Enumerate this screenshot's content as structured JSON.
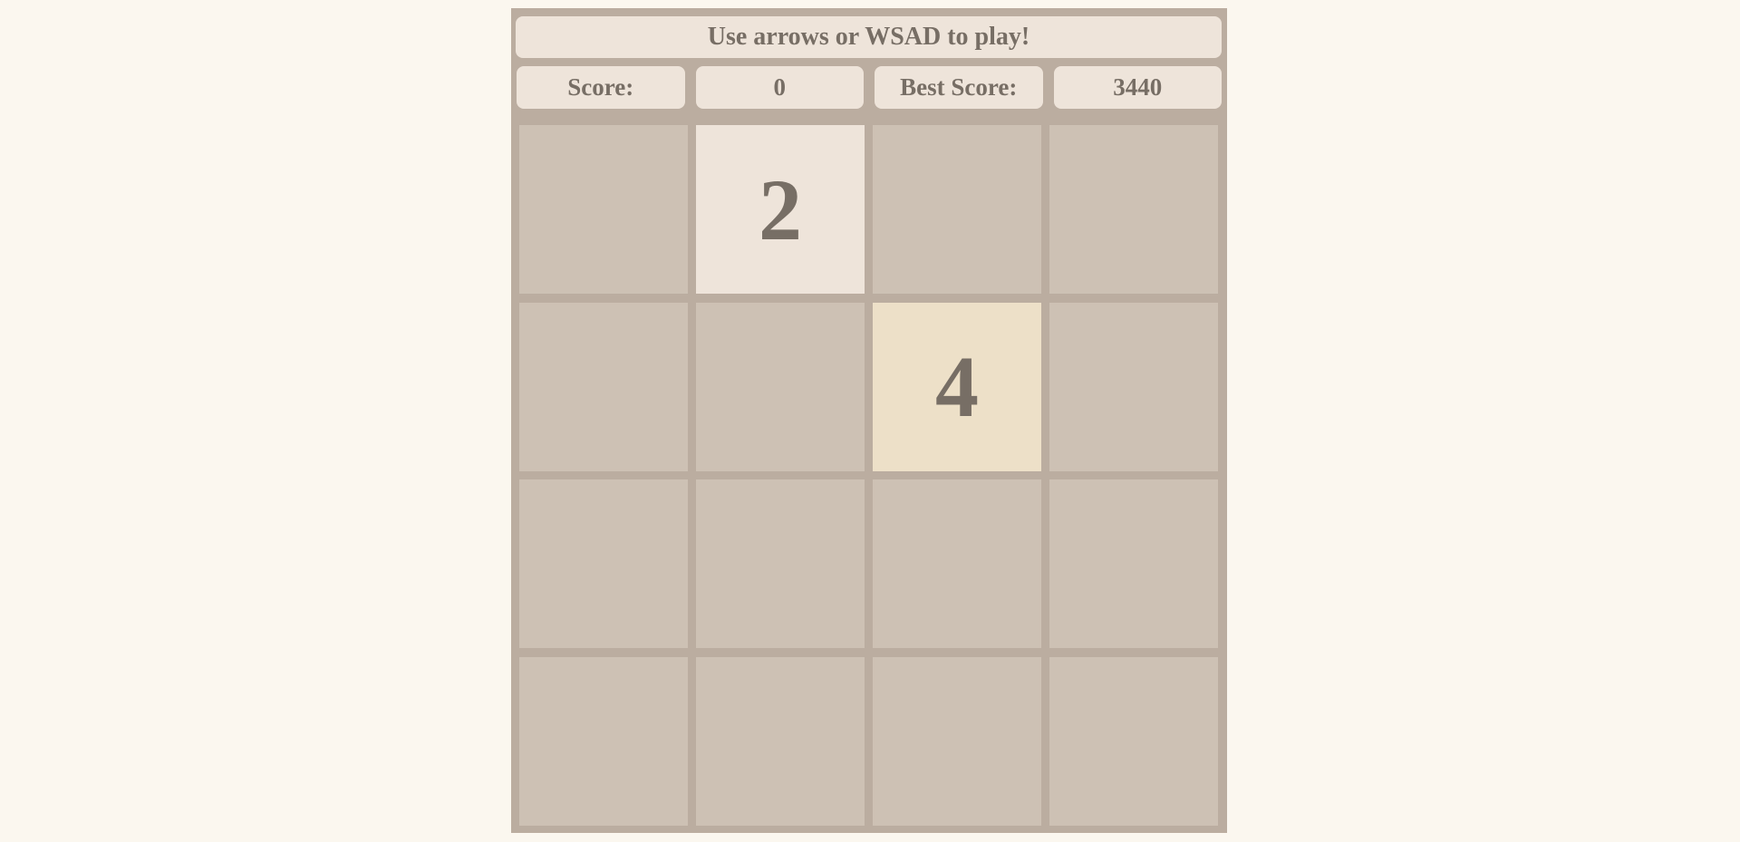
{
  "header": {
    "instructions": "Use arrows or WSAD to play!"
  },
  "scores": {
    "score_label": "Score:",
    "score_value": "0",
    "best_label": "Best Score:",
    "best_value": "3440"
  },
  "board": {
    "size": 4,
    "tiles": [
      [
        "",
        "2",
        "",
        ""
      ],
      [
        "",
        "",
        "4",
        ""
      ],
      [
        "",
        "",
        "",
        ""
      ],
      [
        "",
        "",
        "",
        ""
      ]
    ]
  },
  "colors": {
    "background": "#fbf7ef",
    "board": "#bbada0",
    "empty_cell": "#cdc1b4",
    "tile_2": "#eee4da",
    "tile_4": "#ede0c8",
    "text": "#776e65"
  }
}
